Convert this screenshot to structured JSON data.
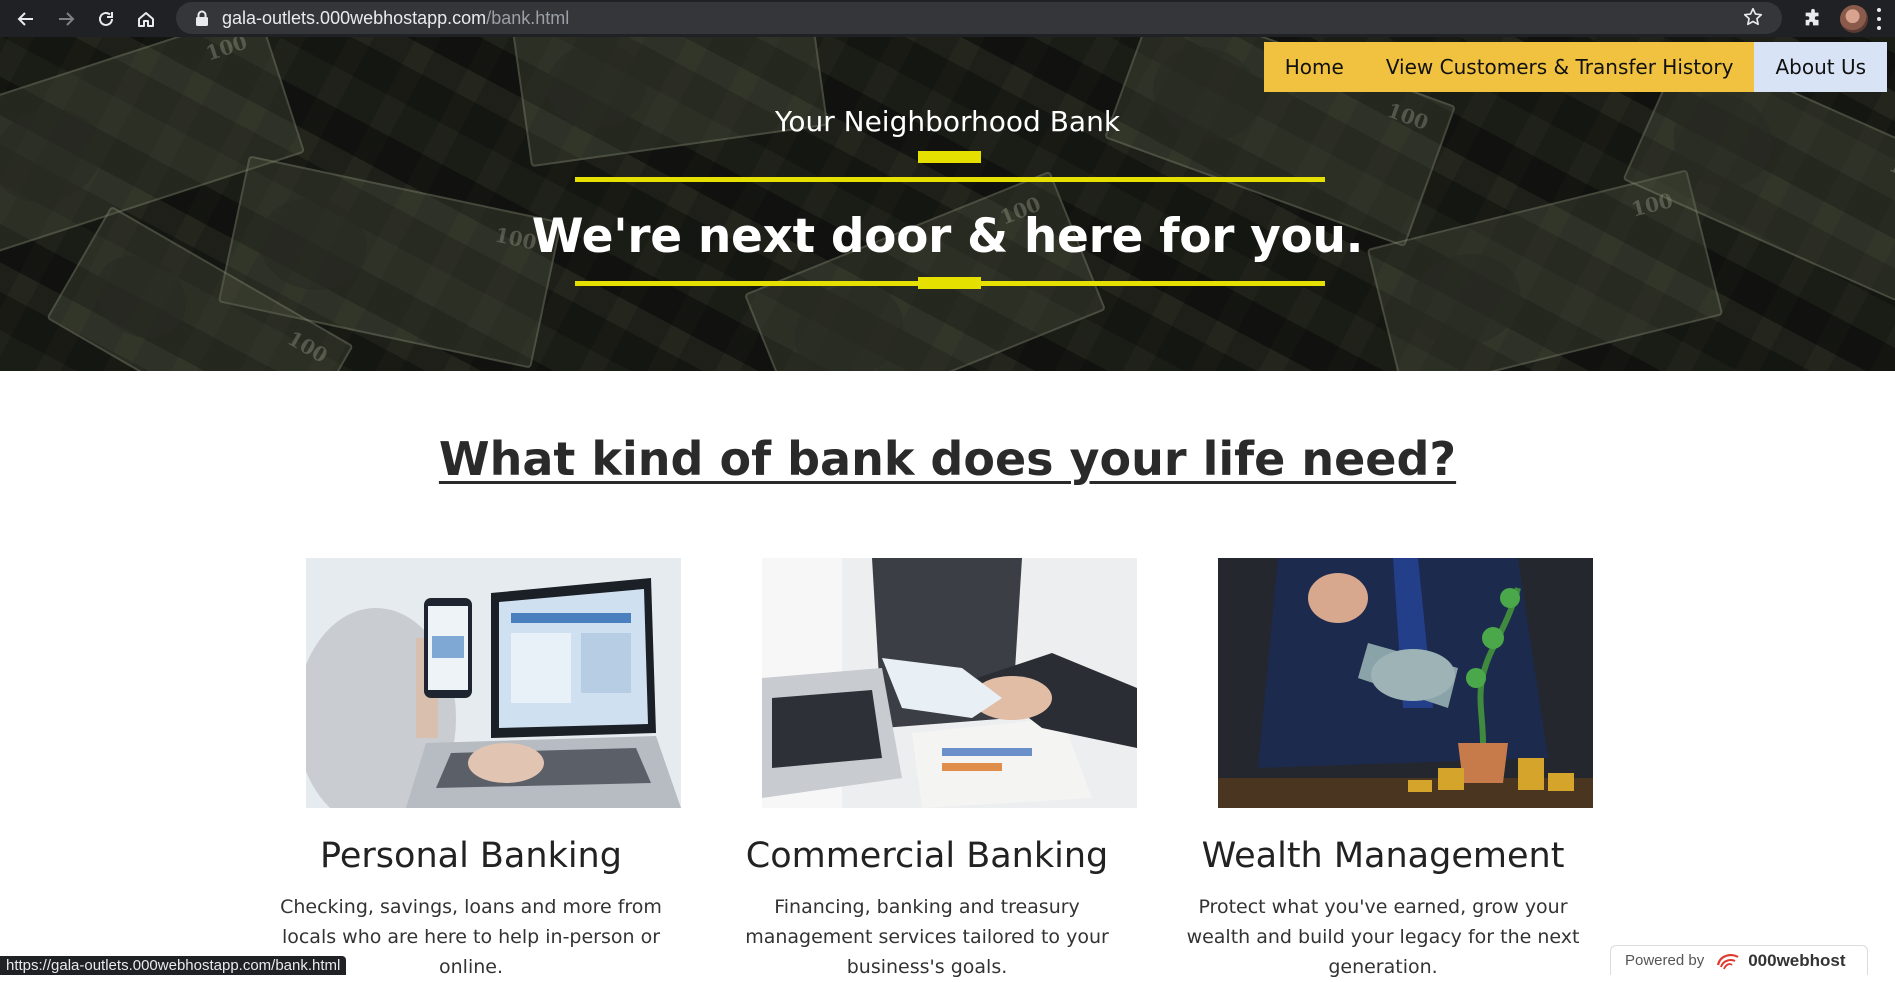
{
  "browser": {
    "url_host": "gala-outlets.000webhostapp.com",
    "url_path": "/bank.html",
    "back_icon": "arrow-left-icon",
    "forward_icon": "arrow-right-icon",
    "reload_icon": "reload-icon",
    "home_icon": "home-icon",
    "lock_icon": "lock-icon",
    "bookmark_icon": "star-icon",
    "extensions_icon": "puzzle-icon",
    "menu_icon": "kebab-menu-icon"
  },
  "nav": {
    "items": [
      {
        "label": "Home"
      },
      {
        "label": "View Customers & Transfer History"
      },
      {
        "label": "About Us"
      }
    ]
  },
  "hero": {
    "tagline": "Your Neighborhood Bank",
    "headline": "We're next door & here for you."
  },
  "main": {
    "section_title": "What kind of bank does your life need?",
    "cards": [
      {
        "title": "Personal Banking",
        "text": "Checking, savings, loans and more from locals who are here to help in-person or online."
      },
      {
        "title": "Commercial Banking",
        "text": "Financing, banking and treasury management services tailored to your business's goals."
      },
      {
        "title": "Wealth Management",
        "text": "Protect what you've earned, grow your wealth and build your legacy for the next generation."
      }
    ]
  },
  "status_bar": {
    "text": "https://gala-outlets.000webhostapp.com/bank.html"
  },
  "badge": {
    "label": "Powered by",
    "brand": "000webhost"
  },
  "colors": {
    "nav_yellow": "#f0c23f",
    "nav_active": "#d8e4f5",
    "accent_bar": "#e6e000",
    "chrome_dark": "#202124"
  }
}
